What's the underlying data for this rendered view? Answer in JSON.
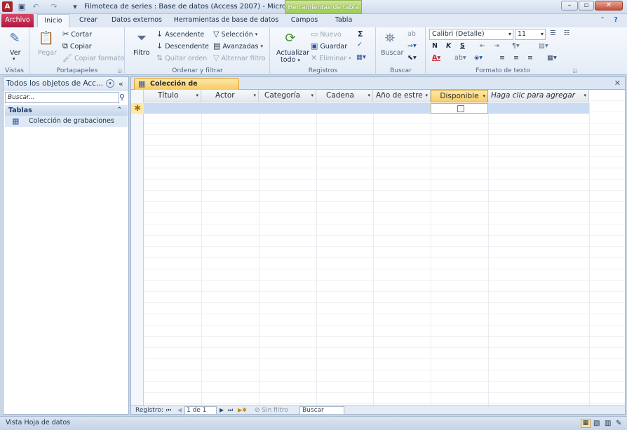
{
  "window": {
    "title": "Filmoteca de series : Base de datos (Access 2007)  -  Micro...",
    "context_tab": "Herramientas de tabla",
    "app_icon": "A"
  },
  "tabs": [
    "Archivo",
    "Inicio",
    "Crear",
    "Datos externos",
    "Herramientas de base de datos",
    "Campos",
    "Tabla"
  ],
  "ribbon": {
    "vistas": {
      "label": "Vistas",
      "ver": "Ver"
    },
    "portapapeles": {
      "label": "Portapapeles",
      "pegar": "Pegar",
      "cortar": "Cortar",
      "copiar": "Copiar",
      "copiar_formato": "Copiar formato"
    },
    "ordenar": {
      "label": "Ordenar y filtrar",
      "filtro": "Filtro",
      "ascendente": "Ascendente",
      "descendente": "Descendente",
      "quitar_orden": "Quitar orden",
      "seleccion": "Selección",
      "avanzadas": "Avanzadas",
      "alternar_filtro": "Alternar filtro"
    },
    "registros": {
      "label": "Registros",
      "actualizar": "Actualizar",
      "todo": "todo",
      "nuevo": "Nuevo",
      "guardar": "Guardar",
      "eliminar": "Eliminar"
    },
    "buscar": {
      "label": "Buscar",
      "buscar": "Buscar"
    },
    "formato": {
      "label": "Formato de texto",
      "font": "Calibri (Detalle)",
      "size": "11"
    }
  },
  "nav": {
    "header": "Todos los objetos de Acc...",
    "search_placeholder": "Buscar...",
    "group": "Tablas",
    "items": [
      "Colección de grabaciones"
    ]
  },
  "document": {
    "tab": "Colección de grabaciones",
    "columns": [
      "Título",
      "Actor",
      "Categoría",
      "Cadena",
      "Año de estre",
      "Disponible",
      "Haga clic para agregar"
    ]
  },
  "record_nav": {
    "label": "Registro:",
    "position": "1 de 1",
    "no_filter": "Sin filtro",
    "search": "Buscar"
  },
  "status": {
    "text": "Vista Hoja de datos"
  }
}
